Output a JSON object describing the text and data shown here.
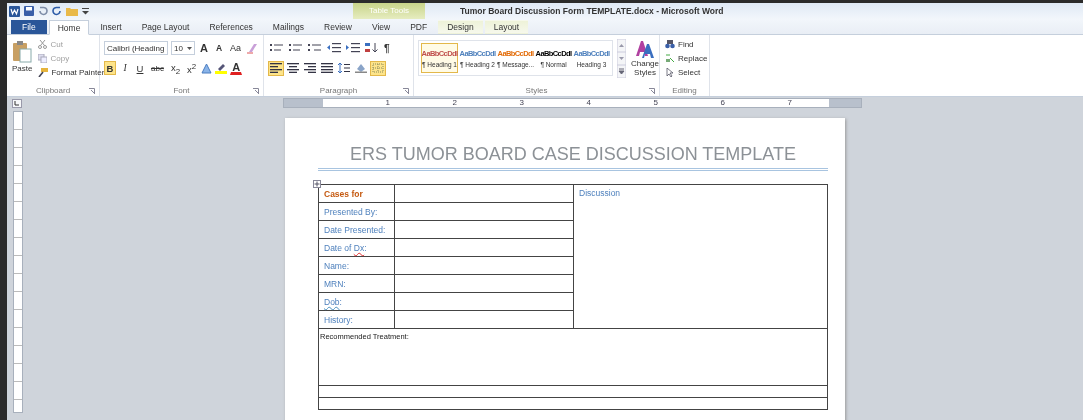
{
  "window": {
    "title": "Tumor Board Discussion Form TEMPLATE.docx - Microsoft Word"
  },
  "contextual_group": {
    "label": "Table Tools"
  },
  "tabs": [
    {
      "label": "File",
      "kind": "file",
      "selected": false
    },
    {
      "label": "Home",
      "kind": "tab",
      "selected": true
    },
    {
      "label": "Insert",
      "kind": "tab",
      "selected": false
    },
    {
      "label": "Page Layout",
      "kind": "tab",
      "selected": false
    },
    {
      "label": "References",
      "kind": "tab",
      "selected": false
    },
    {
      "label": "Mailings",
      "kind": "tab",
      "selected": false
    },
    {
      "label": "Review",
      "kind": "tab",
      "selected": false
    },
    {
      "label": "View",
      "kind": "tab",
      "selected": false
    },
    {
      "label": "PDF",
      "kind": "tab",
      "selected": false
    },
    {
      "label": "Design",
      "kind": "context",
      "selected": false
    },
    {
      "label": "Layout",
      "kind": "context",
      "selected": false
    }
  ],
  "clipboard": {
    "label": "Clipboard",
    "paste": "Paste",
    "items": [
      {
        "label": "Cut",
        "kind": "cut",
        "disabled": true
      },
      {
        "label": "Copy",
        "kind": "copy",
        "disabled": true
      },
      {
        "label": "Format Painter",
        "kind": "painter",
        "disabled": false
      }
    ]
  },
  "font": {
    "label": "Font",
    "name": "Calibri (Heading",
    "size": "10",
    "size_buttons": [
      {
        "label": "A",
        "kind": "grow"
      },
      {
        "label": "A",
        "kind": "shrink"
      },
      {
        "label": "Aa",
        "kind": "case"
      }
    ],
    "format_buttons": [
      {
        "label": "B",
        "kind": "bold",
        "active": true
      },
      {
        "label": "I",
        "kind": "italic",
        "active": false
      },
      {
        "label": "U",
        "kind": "underline",
        "active": false
      },
      {
        "label": "abc",
        "kind": "strike",
        "active": false
      },
      {
        "label": "x$_{2}$",
        "kind": "plain",
        "active": false
      },
      {
        "label": "x$^{2}$",
        "kind": "plain",
        "active": false
      }
    ],
    "color_label": "A"
  },
  "paragraph": {
    "label": "Paragraph",
    "marks": "¶",
    "top": [
      {
        "kind": "bullets",
        "active": false
      },
      {
        "kind": "numbering",
        "active": false
      },
      {
        "kind": "multilevel",
        "active": false
      },
      {
        "kind": "outdent",
        "active": false
      },
      {
        "kind": "indent",
        "active": false
      },
      {
        "kind": "sort",
        "active": false
      }
    ],
    "bottom": [
      {
        "kind": "left",
        "active": true
      },
      {
        "kind": "center",
        "active": false
      },
      {
        "kind": "right",
        "active": false
      },
      {
        "kind": "justify",
        "active": false
      },
      {
        "kind": "spacing",
        "active": false
      },
      {
        "kind": "shading",
        "active": false
      },
      {
        "kind": "borders",
        "active": true
      }
    ]
  },
  "styles": {
    "label": "Styles",
    "items": [
      {
        "preview": "AaBbCcDdI",
        "name": "¶ Heading 1",
        "color": "#c0504d",
        "selected": true
      },
      {
        "preview": "AaBbCcDdI",
        "name": "¶ Heading 2",
        "color": "#4f81bd",
        "selected": false
      },
      {
        "preview": "AaBbCcDdI",
        "name": "¶ Message...",
        "color": "#e36c09",
        "selected": false
      },
      {
        "preview": "AaBbCcDdI",
        "name": "¶ Normal",
        "color": "#000000",
        "selected": false
      },
      {
        "preview": "AaBbCcDdI",
        "name": "Heading 3",
        "color": "#4f81bd",
        "selected": false
      }
    ],
    "change": "Change Styles"
  },
  "editing": {
    "label": "Editing",
    "items": [
      {
        "label": "Find",
        "kind": "find"
      },
      {
        "label": "Replace",
        "kind": "replace"
      },
      {
        "label": "Select",
        "kind": "select"
      }
    ]
  },
  "ruler": {
    "numbers": [
      "1",
      "2",
      "3",
      "4",
      "5",
      "6",
      "7"
    ]
  },
  "document": {
    "title": "ERS TUMOR BOARD CASE DISCUSSION TEMPLATE",
    "discussion": "Discussion",
    "rows": [
      {
        "kind": "heading",
        "parts": [
          {
            "text": "Cases for"
          }
        ]
      },
      {
        "kind": "field",
        "parts": [
          {
            "text": "Presented By:"
          }
        ]
      },
      {
        "kind": "field",
        "parts": [
          {
            "text": "Date Presented:"
          }
        ]
      },
      {
        "kind": "field",
        "parts": [
          {
            "text": "Date of "
          },
          {
            "text": "Dx",
            "misspelled": true
          },
          {
            "text": ":"
          }
        ]
      },
      {
        "kind": "field",
        "parts": [
          {
            "text": "Name:"
          }
        ]
      },
      {
        "kind": "field",
        "parts": [
          {
            "text": "MRN:"
          }
        ]
      },
      {
        "kind": "field",
        "parts": [
          {
            "text": "Dob",
            "grammar_flag": true
          },
          {
            "text": ":"
          }
        ]
      },
      {
        "kind": "field",
        "parts": [
          {
            "text": "History:"
          }
        ]
      }
    ],
    "treatment": "Recommended Treatment:"
  }
}
